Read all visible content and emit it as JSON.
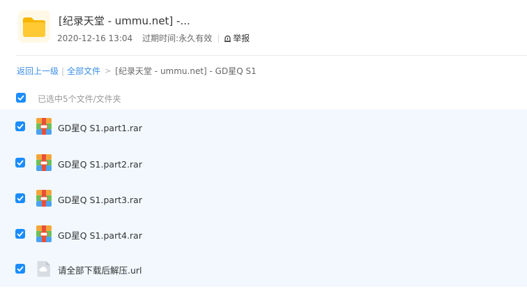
{
  "header": {
    "title": "[纪录天堂 - ummu.net] -...",
    "date": "2020-12-16 13:04",
    "expire_label": "过期时间:",
    "expire_value": "永久有效",
    "report_label": "举报"
  },
  "breadcrumb": {
    "back": "返回上一级",
    "all_files": "全部文件",
    "current": "[纪录天堂 - ummu.net] - GD星Q S1"
  },
  "selection": {
    "text": "已选中5个文件/文件夹"
  },
  "files": [
    {
      "name": "GD星Q S1.part1.rar",
      "icon": "rar-archive-icon"
    },
    {
      "name": "GD星Q S1.part2.rar",
      "icon": "rar-archive-icon"
    },
    {
      "name": "GD星Q S1.part3.rar",
      "icon": "rar-archive-icon"
    },
    {
      "name": "GD星Q S1.part4.rar",
      "icon": "rar-archive-icon"
    },
    {
      "name": "请全部下载后解压.url",
      "icon": "url-file-icon"
    }
  ],
  "colors": {
    "accent": "#1a8cff",
    "link": "#3a8ee6",
    "list_bg": "#f2f8fe"
  }
}
